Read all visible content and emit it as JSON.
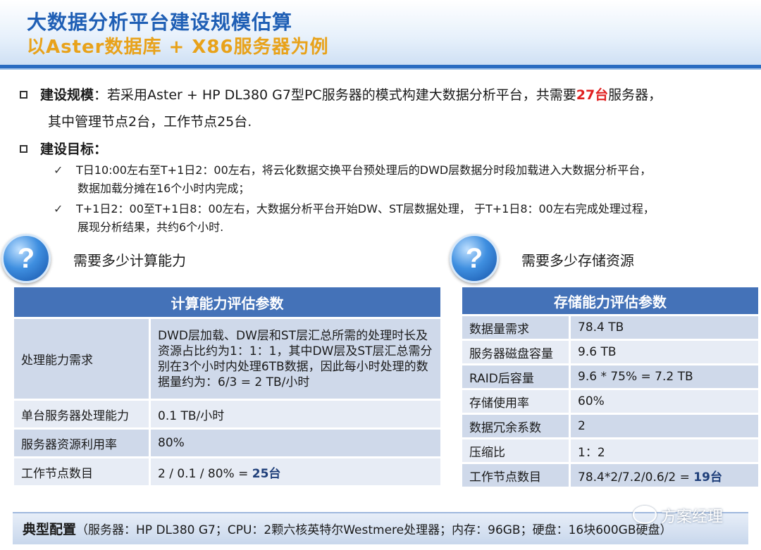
{
  "header": {
    "title": "大数据分析平台建设规模估算",
    "subtitle": "以Aster数据库 + X86服务器为例"
  },
  "scale": {
    "label": "建设规模",
    "text_pre": "：若采用Aster + HP DL380 G7型PC服务器的模式构建大数据分析平台，共需要",
    "highlight": "27台",
    "text_post": "服务器，",
    "line2": "其中管理节点2台，工作节点25台."
  },
  "goals": {
    "label": "建设目标",
    "colon": "：",
    "items": [
      {
        "mark": "✓",
        "line1": "T日10:00左右至T+1日2：00左右，将云化数据交换平台预处理后的DWD层数据分时段加载进入大数据分析平台，",
        "line2": "数据加载分摊在16个小时内完成；"
      },
      {
        "mark": "✓",
        "line1": "T+1日2：00至T+1日8：00左右，大数据分析平台开始DW、ST层数据处理， 于T+1日8：00左右完成处理过程，",
        "line2": "展现分析结果，共约6个小时."
      }
    ]
  },
  "compute": {
    "question": "需要多少计算能力",
    "header": "计算能力评估参数",
    "rows": [
      {
        "k": "处理能力需求",
        "v": "DWD层加载、DW层和ST层汇总所需的处理时长及资源占比约为1：1：1，其中DW层及ST层汇总需分别在3个小时内处理6TB数据，因此每小时处理的数据量约为：6/3 = 2 TB/小时"
      },
      {
        "k": "单台服务器处理能力",
        "v": "0.1 TB/小时"
      },
      {
        "k": "服务器资源利用率",
        "v": "80%"
      },
      {
        "k": "工作节点数目",
        "v_pre": "2 / 0.1 / 80% = ",
        "v_bold": "25台"
      }
    ]
  },
  "storage": {
    "question": "需要多少存储资源",
    "header": "存储能力评估参数",
    "rows": [
      {
        "k": "数据量需求",
        "v": "78.4 TB"
      },
      {
        "k": "服务器磁盘容量",
        "v": "9.6 TB"
      },
      {
        "k": "RAID后容量",
        "v": "9.6 * 75% = 7.2 TB"
      },
      {
        "k": "存储使用率",
        "v": "60%"
      },
      {
        "k": "数据冗余系数",
        "v": "2"
      },
      {
        "k": "压缩比",
        "v": "1：2"
      },
      {
        "k": "工作节点数目",
        "v_pre": "78.4*2/7.2/0.6/2 = ",
        "v_bold": "19台"
      }
    ]
  },
  "footer": {
    "lead": "典型配置",
    "text": "（服务器：HP DL380 G7；CPU：2颗六核英特尔Westmere处理器；内存：96GB；硬盘：16块600GB硬盘）",
    "watermark": "方案经理"
  },
  "icons": {
    "question": "question-mark-icon",
    "check": "checkmark-icon",
    "bullet": "square-bullet-icon"
  },
  "colors": {
    "title": "#1f5fb5",
    "subtitle": "#e8a21a",
    "table_header": "#4472b8",
    "highlight": "#e02020"
  }
}
